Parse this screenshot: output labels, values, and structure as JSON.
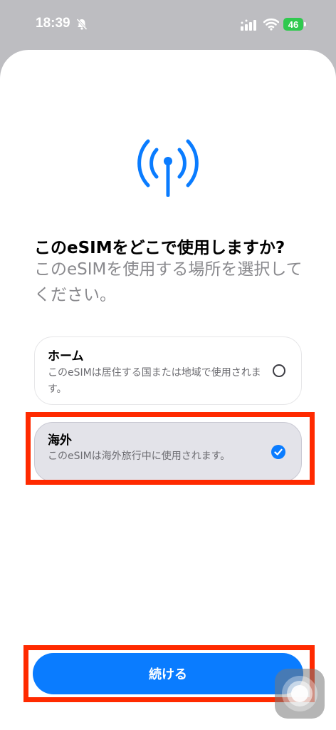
{
  "status_bar": {
    "time": "18:39",
    "battery": "46"
  },
  "header": {
    "icon": "antenna-icon",
    "title": "このeSIMをどこで使用しますか?",
    "subtitle": "このeSIMを使用する場所を選択してください。"
  },
  "options": [
    {
      "title": "ホーム",
      "description": "このeSIMは居住する国または地域で使用されます。",
      "selected": false
    },
    {
      "title": "海外",
      "description": "このeSIMは海外旅行中に使用されます。",
      "selected": true
    }
  ],
  "continue_label": "続ける",
  "colors": {
    "accent": "#0a7cff",
    "highlight": "#ff2a00",
    "battery": "#30c94f"
  }
}
